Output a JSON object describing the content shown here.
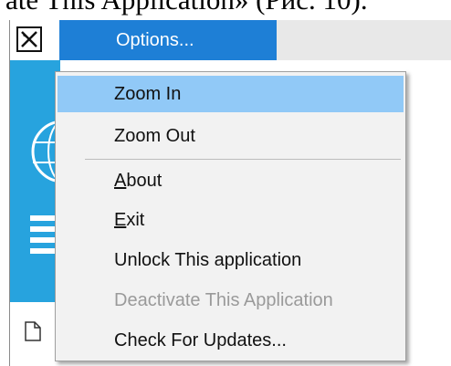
{
  "caption": {
    "text": "ate This Application» (Рис. 10)."
  },
  "titlebar": {
    "options_label": "Options..."
  },
  "menu": {
    "items": [
      {
        "label": "Zoom In",
        "highlighted": true,
        "disabled": false
      },
      {
        "label": "Zoom Out",
        "disabled": false
      },
      {
        "label_accel": "A",
        "label_rest": "bout",
        "disabled": false
      },
      {
        "label_accel": "E",
        "label_rest": "xit",
        "disabled": false
      },
      {
        "label": "Unlock This application",
        "disabled": false
      },
      {
        "label": "Deactivate This Application",
        "disabled": true
      },
      {
        "label": "Check For Updates...",
        "disabled": false
      }
    ]
  },
  "colors": {
    "options_bg": "#1e7fd6",
    "sidebar_bg": "#27a3de",
    "highlight_bg": "#91c9f7",
    "menu_bg": "#f2f2f2",
    "disabled_text": "#9a9a9a"
  },
  "icons": [
    "airplane-icon",
    "globe-icon",
    "menu-lines-icon",
    "document-icon"
  ]
}
